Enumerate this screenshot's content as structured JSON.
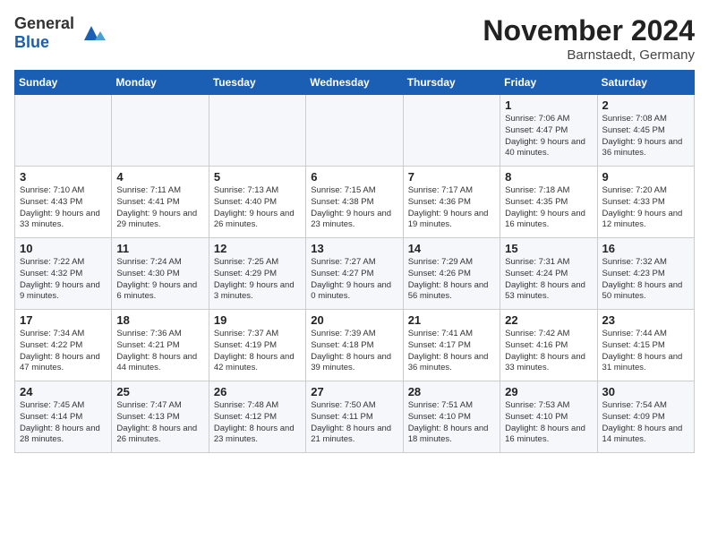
{
  "header": {
    "logo_general": "General",
    "logo_blue": "Blue",
    "month_title": "November 2024",
    "location": "Barnstaedt, Germany"
  },
  "weekdays": [
    "Sunday",
    "Monday",
    "Tuesday",
    "Wednesday",
    "Thursday",
    "Friday",
    "Saturday"
  ],
  "weeks": [
    [
      {
        "day": "",
        "info": ""
      },
      {
        "day": "",
        "info": ""
      },
      {
        "day": "",
        "info": ""
      },
      {
        "day": "",
        "info": ""
      },
      {
        "day": "",
        "info": ""
      },
      {
        "day": "1",
        "info": "Sunrise: 7:06 AM\nSunset: 4:47 PM\nDaylight: 9 hours\nand 40 minutes."
      },
      {
        "day": "2",
        "info": "Sunrise: 7:08 AM\nSunset: 4:45 PM\nDaylight: 9 hours\nand 36 minutes."
      }
    ],
    [
      {
        "day": "3",
        "info": "Sunrise: 7:10 AM\nSunset: 4:43 PM\nDaylight: 9 hours\nand 33 minutes."
      },
      {
        "day": "4",
        "info": "Sunrise: 7:11 AM\nSunset: 4:41 PM\nDaylight: 9 hours\nand 29 minutes."
      },
      {
        "day": "5",
        "info": "Sunrise: 7:13 AM\nSunset: 4:40 PM\nDaylight: 9 hours\nand 26 minutes."
      },
      {
        "day": "6",
        "info": "Sunrise: 7:15 AM\nSunset: 4:38 PM\nDaylight: 9 hours\nand 23 minutes."
      },
      {
        "day": "7",
        "info": "Sunrise: 7:17 AM\nSunset: 4:36 PM\nDaylight: 9 hours\nand 19 minutes."
      },
      {
        "day": "8",
        "info": "Sunrise: 7:18 AM\nSunset: 4:35 PM\nDaylight: 9 hours\nand 16 minutes."
      },
      {
        "day": "9",
        "info": "Sunrise: 7:20 AM\nSunset: 4:33 PM\nDaylight: 9 hours\nand 12 minutes."
      }
    ],
    [
      {
        "day": "10",
        "info": "Sunrise: 7:22 AM\nSunset: 4:32 PM\nDaylight: 9 hours\nand 9 minutes."
      },
      {
        "day": "11",
        "info": "Sunrise: 7:24 AM\nSunset: 4:30 PM\nDaylight: 9 hours\nand 6 minutes."
      },
      {
        "day": "12",
        "info": "Sunrise: 7:25 AM\nSunset: 4:29 PM\nDaylight: 9 hours\nand 3 minutes."
      },
      {
        "day": "13",
        "info": "Sunrise: 7:27 AM\nSunset: 4:27 PM\nDaylight: 9 hours\nand 0 minutes."
      },
      {
        "day": "14",
        "info": "Sunrise: 7:29 AM\nSunset: 4:26 PM\nDaylight: 8 hours\nand 56 minutes."
      },
      {
        "day": "15",
        "info": "Sunrise: 7:31 AM\nSunset: 4:24 PM\nDaylight: 8 hours\nand 53 minutes."
      },
      {
        "day": "16",
        "info": "Sunrise: 7:32 AM\nSunset: 4:23 PM\nDaylight: 8 hours\nand 50 minutes."
      }
    ],
    [
      {
        "day": "17",
        "info": "Sunrise: 7:34 AM\nSunset: 4:22 PM\nDaylight: 8 hours\nand 47 minutes."
      },
      {
        "day": "18",
        "info": "Sunrise: 7:36 AM\nSunset: 4:21 PM\nDaylight: 8 hours\nand 44 minutes."
      },
      {
        "day": "19",
        "info": "Sunrise: 7:37 AM\nSunset: 4:19 PM\nDaylight: 8 hours\nand 42 minutes."
      },
      {
        "day": "20",
        "info": "Sunrise: 7:39 AM\nSunset: 4:18 PM\nDaylight: 8 hours\nand 39 minutes."
      },
      {
        "day": "21",
        "info": "Sunrise: 7:41 AM\nSunset: 4:17 PM\nDaylight: 8 hours\nand 36 minutes."
      },
      {
        "day": "22",
        "info": "Sunrise: 7:42 AM\nSunset: 4:16 PM\nDaylight: 8 hours\nand 33 minutes."
      },
      {
        "day": "23",
        "info": "Sunrise: 7:44 AM\nSunset: 4:15 PM\nDaylight: 8 hours\nand 31 minutes."
      }
    ],
    [
      {
        "day": "24",
        "info": "Sunrise: 7:45 AM\nSunset: 4:14 PM\nDaylight: 8 hours\nand 28 minutes."
      },
      {
        "day": "25",
        "info": "Sunrise: 7:47 AM\nSunset: 4:13 PM\nDaylight: 8 hours\nand 26 minutes."
      },
      {
        "day": "26",
        "info": "Sunrise: 7:48 AM\nSunset: 4:12 PM\nDaylight: 8 hours\nand 23 minutes."
      },
      {
        "day": "27",
        "info": "Sunrise: 7:50 AM\nSunset: 4:11 PM\nDaylight: 8 hours\nand 21 minutes."
      },
      {
        "day": "28",
        "info": "Sunrise: 7:51 AM\nSunset: 4:10 PM\nDaylight: 8 hours\nand 18 minutes."
      },
      {
        "day": "29",
        "info": "Sunrise: 7:53 AM\nSunset: 4:10 PM\nDaylight: 8 hours\nand 16 minutes."
      },
      {
        "day": "30",
        "info": "Sunrise: 7:54 AM\nSunset: 4:09 PM\nDaylight: 8 hours\nand 14 minutes."
      }
    ]
  ]
}
